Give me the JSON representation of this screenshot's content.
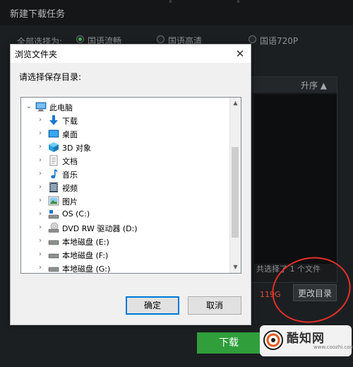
{
  "window": {
    "title": "新建下载任务",
    "quality_label": "全部选择为:",
    "quality_options": [
      {
        "label": "国语流畅",
        "selected": true
      },
      {
        "label": "国语高清",
        "selected": false
      },
      {
        "label": "国语720P",
        "selected": false
      }
    ],
    "sort_label": "升序 ▲",
    "selected_count": "共选择了 1 个文件",
    "size": "119G",
    "change_dir_label": "更改目录",
    "download_label": "下载",
    "accent": "#2f9e3b"
  },
  "dialog": {
    "title": "浏览文件夹",
    "close_glyph": "✕",
    "prompt": "请选择保存目录:",
    "tree": [
      {
        "label": "此电脑",
        "icon": "computer-icon",
        "chevron": "⌄"
      },
      {
        "label": "下载",
        "icon": "download-folder-icon",
        "chevron": "›"
      },
      {
        "label": "桌面",
        "icon": "desktop-folder-icon",
        "chevron": "›"
      },
      {
        "label": "3D 对象",
        "icon": "3d-objects-icon",
        "chevron": "›"
      },
      {
        "label": "文档",
        "icon": "documents-icon",
        "chevron": "›"
      },
      {
        "label": "音乐",
        "icon": "music-icon",
        "chevron": "›"
      },
      {
        "label": "视频",
        "icon": "video-icon",
        "chevron": "›"
      },
      {
        "label": "图片",
        "icon": "pictures-icon",
        "chevron": "›"
      },
      {
        "label": "OS (C:)",
        "icon": "os-drive-icon",
        "chevron": "›"
      },
      {
        "label": "DVD RW 驱动器 (D:)",
        "icon": "dvd-drive-icon",
        "chevron": "›"
      },
      {
        "label": "本地磁盘 (E:)",
        "icon": "disk-drive-icon",
        "chevron": "›"
      },
      {
        "label": "本地磁盘 (F:)",
        "icon": "disk-drive-icon",
        "chevron": "›"
      },
      {
        "label": "本地磁盘 (G:)",
        "icon": "disk-drive-icon",
        "chevron": "›"
      }
    ],
    "ok_label": "确定",
    "cancel_label": "取消"
  },
  "watermark": {
    "text": "酷知网",
    "url": "www.coozhi.com"
  }
}
